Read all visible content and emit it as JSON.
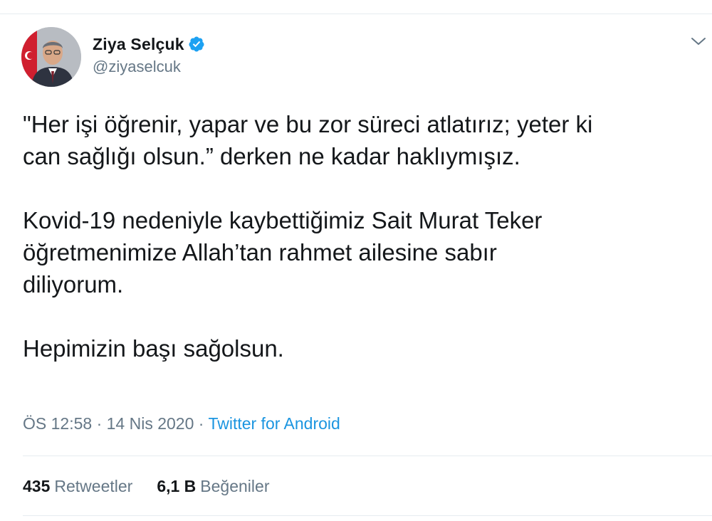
{
  "author": {
    "display_name": "Ziya Selçuk",
    "handle": "@ziyaselcuk",
    "verified": true,
    "avatar_icon": "profile-photo"
  },
  "tweet": {
    "paragraphs": [
      "\"Her işi öğrenir, yapar ve bu zor süreci atlatırız; yeter ki\ncan sağlığı olsun.” derken ne kadar haklıymışız.",
      "Kovid-19 nedeniyle kaybettiğimiz Sait Murat Teker\nöğretmenimize Allah’tan rahmet ailesine sabır\ndiliyorum.",
      "Hepimizin başı sağolsun."
    ],
    "time": "ÖS 12:58",
    "date": "14 Nis 2020",
    "separator": "·",
    "source": "Twitter for Android"
  },
  "stats": {
    "retweets_count": "435",
    "retweets_label": "Retweetler",
    "likes_count": "6,1 B",
    "likes_label": "Beğeniler"
  },
  "colors": {
    "text": "#14171a",
    "secondary": "#657786",
    "link": "#1b95e0",
    "verified": "#1da1f2",
    "divider": "#e6ecf0"
  }
}
